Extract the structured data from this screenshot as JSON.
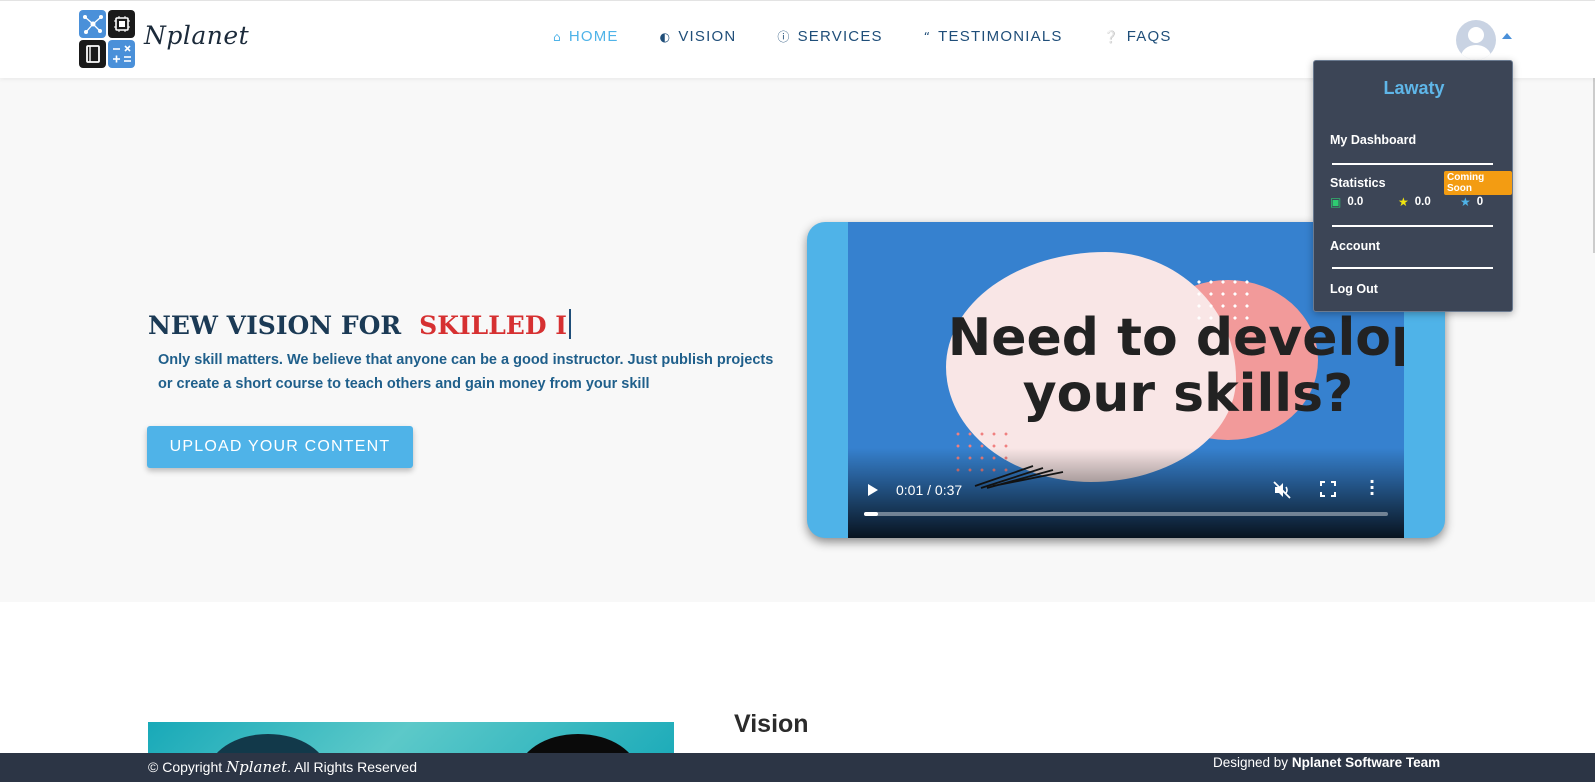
{
  "brand": {
    "name": "Nplanet"
  },
  "nav": {
    "items": [
      {
        "label": "HOME",
        "icon": "home-icon",
        "active": true
      },
      {
        "label": "VISION",
        "icon": "brain-icon",
        "active": false
      },
      {
        "label": "SERVICES",
        "icon": "info-icon",
        "active": false
      },
      {
        "label": "TESTIMONIALS",
        "icon": "quote-icon",
        "active": false
      },
      {
        "label": "FAQS",
        "icon": "question-icon",
        "active": false
      }
    ]
  },
  "user_menu": {
    "username": "Lawaty",
    "dashboard_label": "My Dashboard",
    "statistics_label": "Statistics",
    "coming_soon_label": "Coming Soon",
    "stats": [
      {
        "icon": "money-icon",
        "value": "0.0",
        "color": "#2ecc71"
      },
      {
        "icon": "star-icon",
        "value": "0.0",
        "color": "#f1e40f"
      },
      {
        "icon": "star-icon",
        "value": "0",
        "color": "#4fb3e8"
      }
    ],
    "account_label": "Account",
    "logout_label": "Log Out"
  },
  "hero": {
    "title_static": "NEW VISION FOR",
    "title_typed": "SKILLED I",
    "description": "Only skill matters. We believe that anyone can be a good instructor. Just publish projects or create a short course to teach others and gain money from your skill",
    "upload_button": "UPLOAD YOUR CONTENT"
  },
  "video": {
    "overlay_text": "Need to develop your skills?",
    "time": "0:01 / 0:37",
    "progress": 0.027
  },
  "vision": {
    "title": "Vision"
  },
  "footer": {
    "copyright_prefix": "© Copyright",
    "copyright_brand": "Nplanet",
    "copyright_suffix": ". All Rights Reserved",
    "designed_prefix": "Designed by",
    "designed_team": "Nplanet Software Team"
  },
  "colors": {
    "accent": "#4fb3e8",
    "navy": "#1f4e79",
    "typed_red": "#d63031",
    "badge": "#f39c12",
    "footer_bg": "#2c3545"
  }
}
